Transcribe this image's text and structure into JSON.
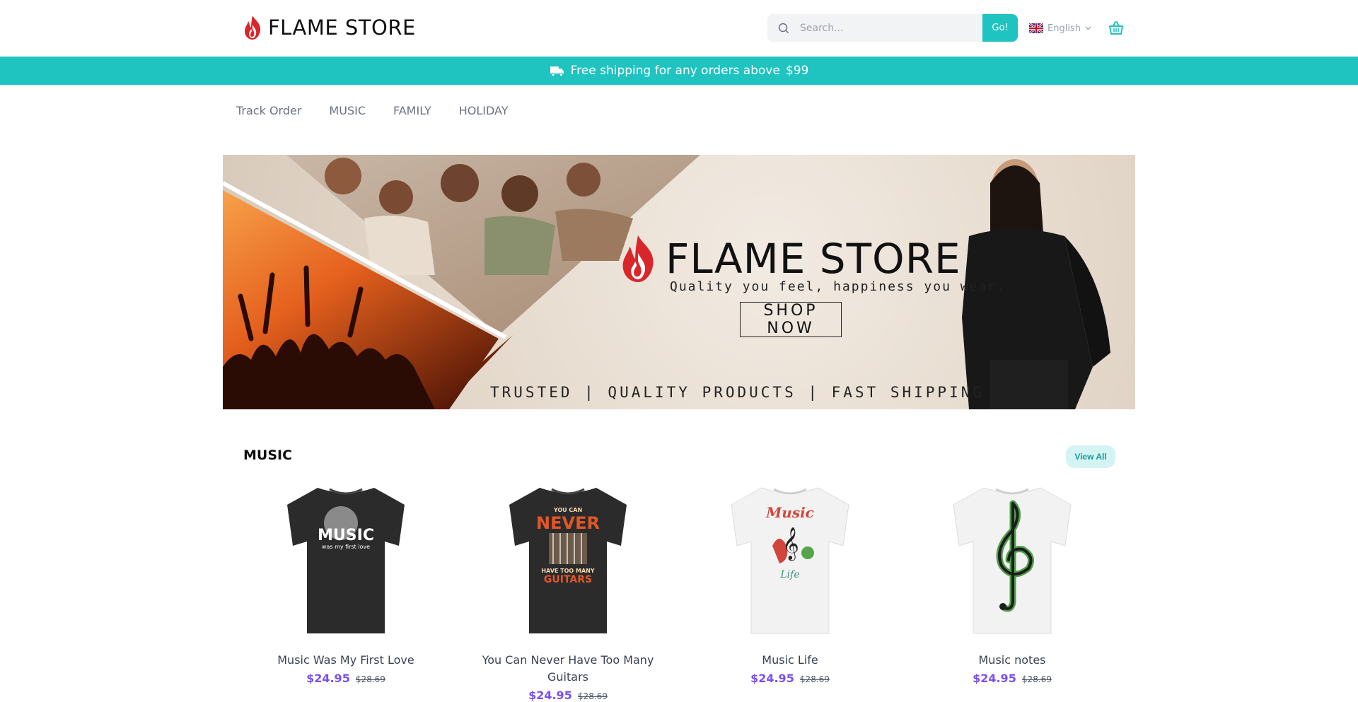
{
  "header": {
    "logo_text": "FLAME STORE",
    "search_placeholder": "Search...",
    "go_label": "Go!",
    "language": "English"
  },
  "shipping_bar": {
    "text": "Free shipping for any orders above",
    "amount": "$99"
  },
  "nav": {
    "items": [
      {
        "label": "Track Order"
      },
      {
        "label": "MUSIC"
      },
      {
        "label": "FAMILY"
      },
      {
        "label": "HOLIDAY"
      }
    ]
  },
  "hero": {
    "brand": "FLAME STORE",
    "tagline": "Quality you feel, happiness you wear.",
    "cta": "SHOP NOW",
    "bottom_line": "TRUSTED | QUALITY PRODUCTS | FAST SHIPPING"
  },
  "section": {
    "title": "MUSIC",
    "view_all": "View All"
  },
  "products": [
    {
      "name": "Music Was My First Love",
      "price": "$24.95",
      "old_price": "$28.69",
      "shirt_color": "#2b2b2b",
      "print": "MUSIC",
      "print_sub": "was my first love"
    },
    {
      "name": "You Can Never Have Too Many Guitars",
      "price": "$24.95",
      "old_price": "$28.69",
      "shirt_color": "#2b2b2b",
      "print": "NEVER",
      "print_sub": "HAVE TOO MANY GUITARS"
    },
    {
      "name": "Music Life",
      "price": "$24.95",
      "old_price": "$28.69",
      "shirt_color": "#f2f2f2",
      "print": "Music",
      "print_sub": "Life"
    },
    {
      "name": "Music notes",
      "price": "$24.95",
      "old_price": "$28.69",
      "shirt_color": "#f2f2f2",
      "print": "",
      "print_sub": ""
    }
  ],
  "colors": {
    "accent": "#1fc3c0",
    "price": "#7b50f0"
  }
}
